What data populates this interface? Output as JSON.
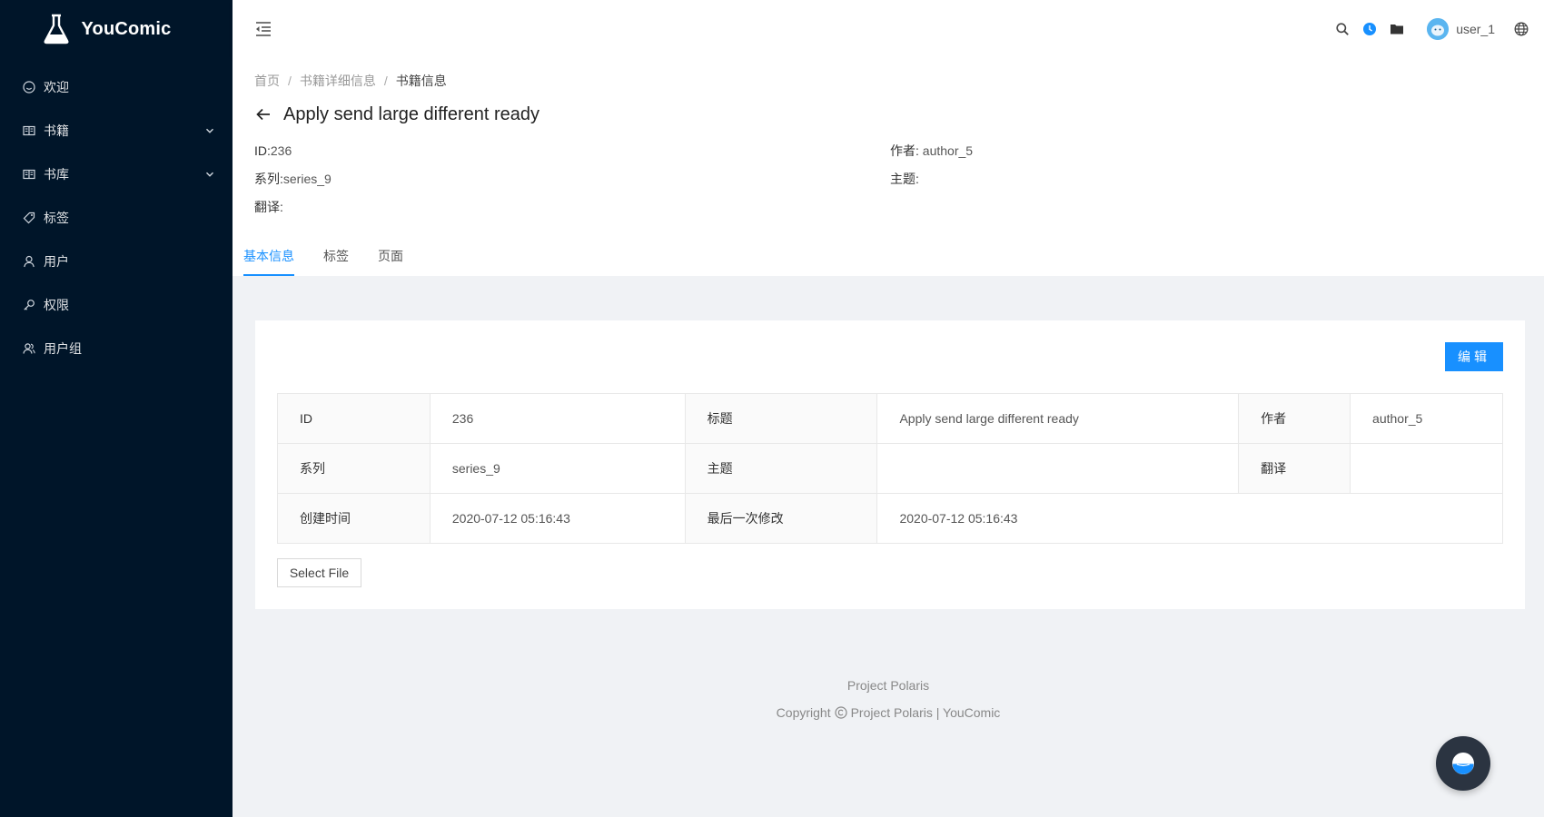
{
  "app": {
    "name": "YouComic"
  },
  "sidebar": {
    "items": [
      {
        "label": "欢迎",
        "icon": "smile-icon",
        "has_arrow": false
      },
      {
        "label": "书籍",
        "icon": "book-icon",
        "has_arrow": true
      },
      {
        "label": "书库",
        "icon": "library-icon",
        "has_arrow": true
      },
      {
        "label": "标签",
        "icon": "tag-icon",
        "has_arrow": false
      },
      {
        "label": "用户",
        "icon": "user-icon",
        "has_arrow": false
      },
      {
        "label": "权限",
        "icon": "key-icon",
        "has_arrow": false
      },
      {
        "label": "用户组",
        "icon": "team-icon",
        "has_arrow": false
      }
    ]
  },
  "header": {
    "user_name": "user_1"
  },
  "breadcrumb": {
    "items": [
      "首页",
      "书籍详细信息",
      "书籍信息"
    ]
  },
  "page": {
    "title": "Apply send large different ready",
    "desc": {
      "id_label": "ID:",
      "id_value": "236",
      "author_label": "作者:",
      "author_value": "author_5",
      "series_label": "系列:",
      "series_value": "series_9",
      "theme_label": "主题:",
      "theme_value": "",
      "translator_label": "翻译:",
      "translator_value": ""
    },
    "tabs": [
      "基本信息",
      "标签",
      "页面"
    ]
  },
  "card": {
    "edit_label": "编辑",
    "select_file_label": "Select File",
    "rows": [
      [
        {
          "label": "ID",
          "value": "236"
        },
        {
          "label": "标题",
          "value": "Apply send large different ready"
        },
        {
          "label": "作者",
          "value": "author_5"
        }
      ],
      [
        {
          "label": "系列",
          "value": "series_9"
        },
        {
          "label": "主题",
          "value": ""
        },
        {
          "label": "翻译",
          "value": ""
        }
      ],
      [
        {
          "label": "创建时间",
          "value": "2020-07-12 05:16:43"
        },
        {
          "label": "最后一次修改",
          "value": "2020-07-12 05:16:43"
        }
      ]
    ]
  },
  "footer": {
    "link": "Project Polaris",
    "copyright_prefix": "Copyright",
    "copyright_text": "Project Polaris | YouComic"
  },
  "colors": {
    "sidebar_bg": "#001529",
    "primary": "#1890ff",
    "page_bg": "#f0f2f5"
  }
}
